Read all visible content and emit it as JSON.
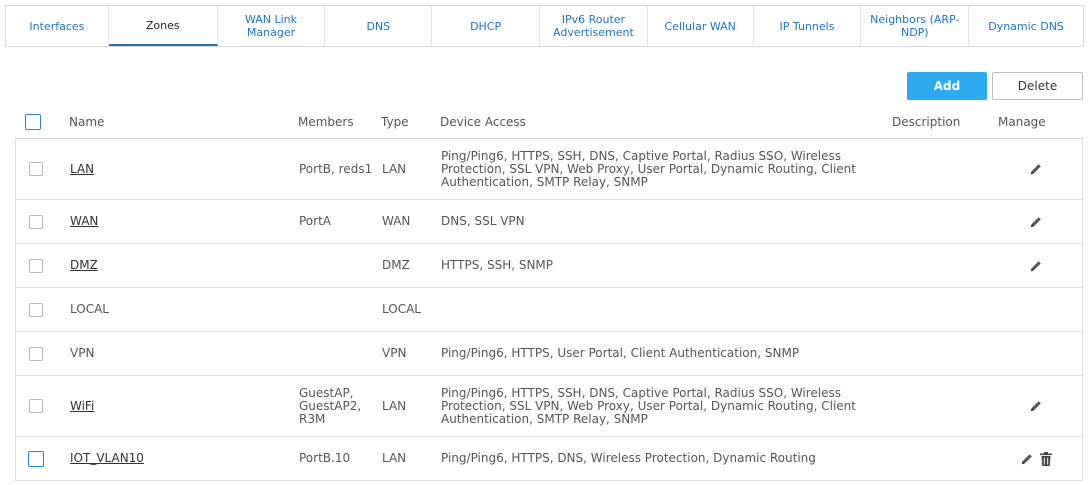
{
  "tabs": [
    {
      "label": "Interfaces",
      "active": false
    },
    {
      "label": "Zones",
      "active": true
    },
    {
      "label": "WAN Link Manager",
      "active": false
    },
    {
      "label": "DNS",
      "active": false
    },
    {
      "label": "DHCP",
      "active": false
    },
    {
      "label": "IPv6 Router Advertisement",
      "active": false
    },
    {
      "label": "Cellular WAN",
      "active": false
    },
    {
      "label": "IP Tunnels",
      "active": false
    },
    {
      "label": "Neighbors (ARP-NDP)",
      "active": false
    },
    {
      "label": "Dynamic DNS",
      "active": false
    }
  ],
  "toolbar": {
    "add_label": "Add",
    "delete_label": "Delete"
  },
  "table": {
    "headers": {
      "name": "Name",
      "members": "Members",
      "type": "Type",
      "device_access": "Device Access",
      "description": "Description",
      "manage": "Manage"
    },
    "rows": [
      {
        "name": "LAN",
        "link": true,
        "members": "PortB, reds1",
        "type": "LAN",
        "device_access": "Ping/Ping6, HTTPS, SSH, DNS, Captive Portal, Radius SSO, Wireless Protection, SSL VPN, Web Proxy, User Portal, Dynamic Routing, Client Authentication, SMTP Relay, SNMP",
        "description": "",
        "edit": true,
        "delete": false
      },
      {
        "name": "WAN",
        "link": true,
        "members": "PortA",
        "type": "WAN",
        "device_access": "DNS, SSL VPN",
        "description": "",
        "edit": true,
        "delete": false
      },
      {
        "name": "DMZ",
        "link": true,
        "members": "",
        "type": "DMZ",
        "device_access": "HTTPS, SSH, SNMP",
        "description": "",
        "edit": true,
        "delete": false
      },
      {
        "name": "LOCAL",
        "link": false,
        "members": "",
        "type": "LOCAL",
        "device_access": "",
        "description": "",
        "edit": false,
        "delete": false
      },
      {
        "name": "VPN",
        "link": false,
        "members": "",
        "type": "VPN",
        "device_access": "Ping/Ping6, HTTPS, User Portal, Client Authentication, SNMP",
        "description": "",
        "edit": false,
        "delete": false
      },
      {
        "name": "WiFi",
        "link": true,
        "members": "GuestAP, GuestAP2, R3M",
        "type": "LAN",
        "device_access": "Ping/Ping6, HTTPS, SSH, DNS, Captive Portal, Radius SSO, Wireless Protection, SSL VPN, Web Proxy, User Portal, Dynamic Routing, Client Authentication, SMTP Relay, SNMP",
        "description": "",
        "edit": true,
        "delete": false
      },
      {
        "name": "IOT_VLAN10",
        "link": true,
        "members": "PortB.10",
        "type": "LAN",
        "device_access": "Ping/Ping6, HTTPS, DNS, Wireless Protection, Dynamic Routing",
        "description": "",
        "edit": true,
        "delete": true
      }
    ]
  },
  "colors": {
    "accent": "#2eaaf0",
    "tab_text": "#1e73be",
    "checkbox_blue": "#2a82d6"
  }
}
